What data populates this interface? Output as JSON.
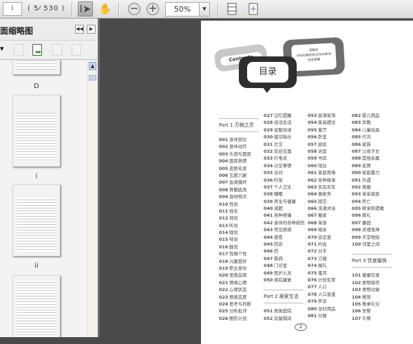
{
  "toolbar": {
    "page_value": "i",
    "page_count": "( 5⁄ 530 )",
    "zoom_value": "50%",
    "zoom_drop": "▼"
  },
  "sidebar": {
    "title": "面缩略图",
    "thumb_labels": [
      "D",
      "i",
      "ii"
    ],
    "collapse": "◀◀",
    "expand": "▶"
  },
  "page": {
    "bubble_contents": "Contents",
    "bubble_title": "目录",
    "bubble_tagline": [
      "话题式",
      "500主题会话10000单词",
      "完全掌握"
    ],
    "page_number": "2",
    "columns": [
      [
        {
          "part": "Part 1 万物之灵"
        },
        [
          "001",
          "身体部位"
        ],
        [
          "002",
          "身体动作"
        ],
        [
          "003",
          "头部与面部"
        ],
        [
          "004",
          "面部表情"
        ],
        [
          "005",
          "皮肤毛发"
        ],
        [
          "006",
          "五脏六腑"
        ],
        [
          "007",
          "血液循环"
        ],
        [
          "008",
          "骨骼肌肉"
        ],
        [
          "009",
          "身材特点"
        ],
        [
          "010",
          "性别"
        ],
        [
          "011",
          "姓名"
        ],
        [
          "012",
          "视觉"
        ],
        [
          "013",
          "听觉"
        ],
        [
          "014",
          "嗅觉"
        ],
        [
          "015",
          "味觉"
        ],
        [
          "016",
          "触觉"
        ],
        [
          "017",
          "性格个性"
        ],
        [
          "018",
          "兴趣爱好"
        ],
        [
          "019",
          "职业身份"
        ],
        [
          "020",
          "思想品德"
        ],
        [
          "021",
          "情绪心情"
        ],
        [
          "022",
          "心理状态"
        ],
        [
          "023",
          "情感态度"
        ],
        [
          "024",
          "思考与判断"
        ],
        [
          "025",
          "分析批评"
        ],
        [
          "026",
          "图形计划"
        ]
      ],
      [
        [
          "027",
          "记忆提醒"
        ],
        [
          "028",
          "谈话会话"
        ],
        [
          "029",
          "说服劝诱"
        ],
        [
          "030",
          "建议暗示"
        ],
        [
          "031",
          "社交"
        ],
        [
          "032",
          "欢迎见面"
        ],
        [
          "033",
          "打电话"
        ],
        [
          "034",
          "讨论事情"
        ],
        [
          "035",
          "派对"
        ],
        [
          "036",
          "吵架"
        ],
        [
          "037",
          "个人卫生"
        ],
        [
          "038",
          "睡眠"
        ],
        [
          "039",
          "养生与健康"
        ],
        [
          "040",
          "减肥"
        ],
        [
          "041",
          "各种疼痛"
        ],
        [
          "042",
          "身体的各种损伤"
        ],
        [
          "043",
          "常见疾病"
        ],
        [
          "044",
          "感冒"
        ],
        [
          "045",
          "药店"
        ],
        [
          "046",
          "药"
        ],
        [
          "047",
          "看病"
        ],
        [
          "048",
          "门诊室"
        ],
        [
          "049",
          "医护人员"
        ],
        [
          "050",
          "病后康复"
        ],
        {
          "part": "Part 2 居家生活"
        },
        [
          "051",
          "居家庭院"
        ],
        [
          "052",
          "房屋隔间"
        ]
      ],
      [
        [
          "053",
          "装潢家饰"
        ],
        [
          "054",
          "家具摆设"
        ],
        [
          "055",
          "客厅"
        ],
        [
          "056",
          "卧室"
        ],
        [
          "057",
          "厨房"
        ],
        [
          "058",
          "浴室"
        ],
        [
          "059",
          "书房"
        ],
        [
          "060",
          "阳台"
        ],
        [
          "061",
          "家庭用电"
        ],
        [
          "062",
          "各种账单"
        ],
        [
          "063",
          "买房买车"
        ],
        [
          "064",
          "做家务"
        ],
        [
          "065",
          "园艺"
        ],
        [
          "066",
          "洗澡沐浴"
        ],
        [
          "067",
          "搬家"
        ],
        [
          "068",
          "单身"
        ],
        [
          "069",
          "相亲"
        ],
        [
          "070",
          "谈恋爱"
        ],
        [
          "071",
          "约会"
        ],
        [
          "072",
          "分手"
        ],
        [
          "073",
          "订婚"
        ],
        [
          "074",
          "婚礼"
        ],
        [
          "075",
          "蜜月"
        ],
        [
          "076",
          "计划生育"
        ],
        [
          "077",
          "人口"
        ],
        [
          "078",
          "人口普查"
        ],
        [
          "079",
          "怀孕"
        ],
        [
          "080",
          "孕妇用品"
        ],
        [
          "081",
          "分娩"
        ]
      ],
      [
        [
          "082",
          "婴儿用品"
        ],
        [
          "083",
          "早教"
        ],
        [
          "084",
          "儿童玩具"
        ],
        [
          "085",
          "代沟"
        ],
        [
          "086",
          "家族"
        ],
        [
          "087",
          "父母子女"
        ],
        [
          "088",
          "其他亲属"
        ],
        [
          "089",
          "友情"
        ],
        [
          "090",
          "家庭暴力"
        ],
        [
          "091",
          "外遇"
        ],
        [
          "092",
          "离婚"
        ],
        [
          "093",
          "单亲家庭"
        ],
        [
          "094",
          "死亡"
        ],
        [
          "095",
          "继承和遗嘱"
        ],
        [
          "096",
          "葬礼"
        ],
        [
          "097",
          "墓园"
        ],
        [
          "098",
          "灵魂鬼神"
        ],
        [
          "099",
          "天堂地狱"
        ],
        [
          "100",
          "邻里之间"
        ],
        {
          "part": "Part 3 饮食服饰"
        },
        [
          "101",
          "健康饮食"
        ],
        [
          "102",
          "食物保存"
        ],
        [
          "103",
          "食物过敏"
        ],
        [
          "104",
          "餐馆"
        ],
        [
          "105",
          "餐桌礼仪"
        ],
        [
          "106",
          "早餐"
        ],
        [
          "107",
          "午餐"
        ]
      ]
    ]
  }
}
